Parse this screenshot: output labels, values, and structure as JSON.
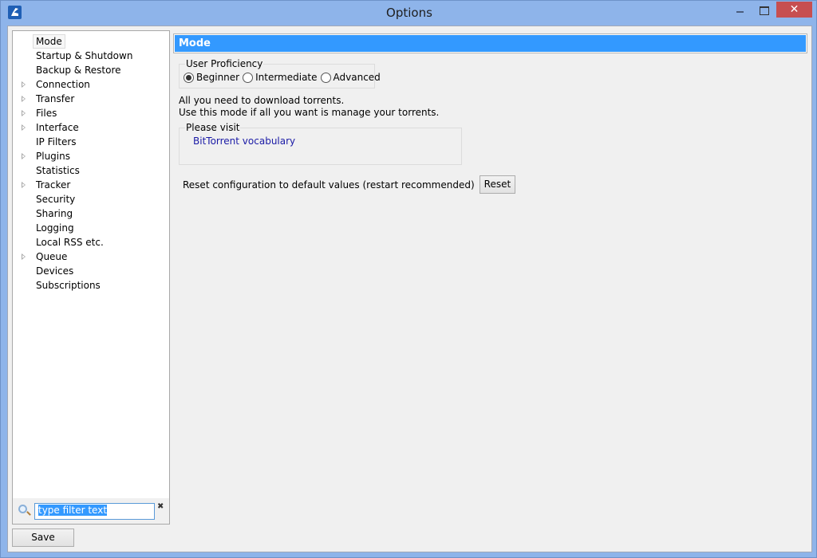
{
  "window": {
    "title": "Options",
    "close_glyph": "✕"
  },
  "sidebar": {
    "items": [
      {
        "label": "Mode",
        "expandable": false,
        "selected": true
      },
      {
        "label": "Startup & Shutdown",
        "expandable": false
      },
      {
        "label": "Backup & Restore",
        "expandable": false
      },
      {
        "label": "Connection",
        "expandable": true
      },
      {
        "label": "Transfer",
        "expandable": true
      },
      {
        "label": "Files",
        "expandable": true
      },
      {
        "label": "Interface",
        "expandable": true
      },
      {
        "label": "IP Filters",
        "expandable": false
      },
      {
        "label": "Plugins",
        "expandable": true
      },
      {
        "label": "Statistics",
        "expandable": false
      },
      {
        "label": "Tracker",
        "expandable": true
      },
      {
        "label": "Security",
        "expandable": false
      },
      {
        "label": "Sharing",
        "expandable": false
      },
      {
        "label": "Logging",
        "expandable": false
      },
      {
        "label": "Local RSS etc.",
        "expandable": false
      },
      {
        "label": "Queue",
        "expandable": true
      },
      {
        "label": "Devices",
        "expandable": false
      },
      {
        "label": "Subscriptions",
        "expandable": false
      }
    ],
    "filter": {
      "value": "type filter text",
      "clear_glyph": "✖"
    },
    "save_label": "Save"
  },
  "main": {
    "section_title": "Mode",
    "proficiency": {
      "group_label": "User Proficiency",
      "options": [
        {
          "label": "Beginner",
          "checked": true
        },
        {
          "label": "Intermediate",
          "checked": false
        },
        {
          "label": "Advanced",
          "checked": false
        }
      ]
    },
    "description": {
      "line1": "All you need to download torrents.",
      "line2": "Use this mode if all you want is manage your torrents."
    },
    "visit": {
      "group_label": "Please visit",
      "link_text": "BitTorrent vocabulary"
    },
    "reset": {
      "label": "Reset configuration to default values (restart recommended)",
      "button_label": "Reset"
    }
  },
  "colors": {
    "header_accent": "#3399ff",
    "link": "#1a1aa6",
    "close_button": "#c74f50",
    "window_frame": "#8eb4ea"
  }
}
